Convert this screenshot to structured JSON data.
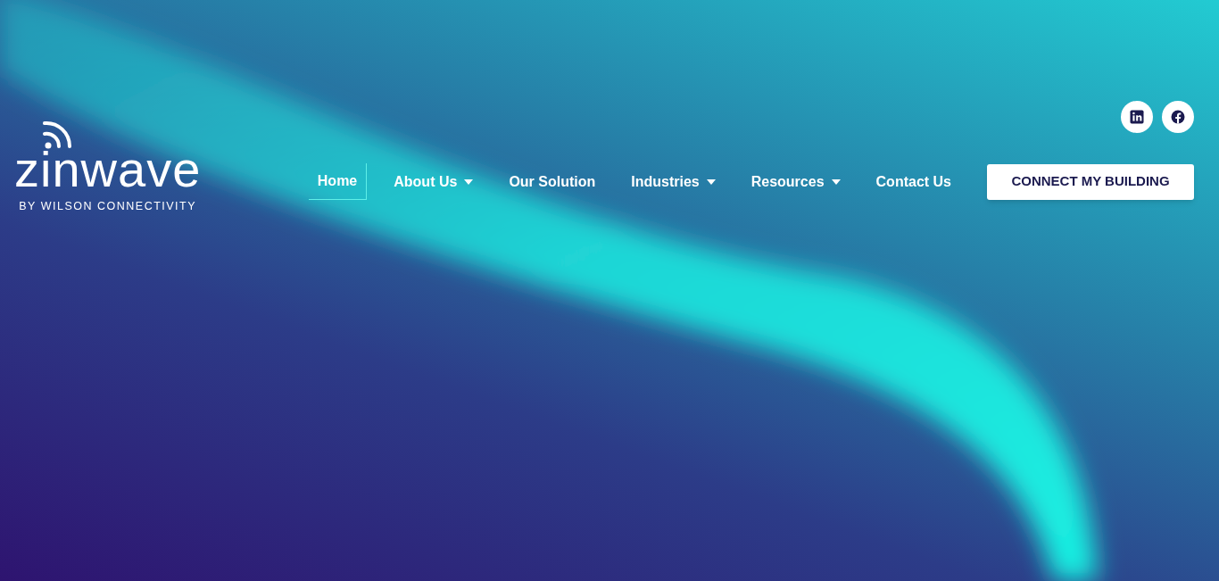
{
  "logo": {
    "wordmark": "zinwave",
    "tagline": "BY WILSON CONNECTIVITY"
  },
  "social_links": [
    {
      "kind": "linkedin"
    },
    {
      "kind": "facebook"
    }
  ],
  "nav": {
    "items": [
      {
        "label": "Home",
        "selected": true,
        "has_dropdown": false
      },
      {
        "label": "About Us",
        "selected": false,
        "has_dropdown": true
      },
      {
        "label": "Our Solution",
        "selected": false,
        "has_dropdown": false
      },
      {
        "label": "Industries",
        "selected": false,
        "has_dropdown": true
      },
      {
        "label": "Resources",
        "selected": false,
        "has_dropdown": true
      },
      {
        "label": "Contact Us",
        "selected": false,
        "has_dropdown": false
      }
    ]
  },
  "cta_button": "CONNECT MY BUILDING"
}
